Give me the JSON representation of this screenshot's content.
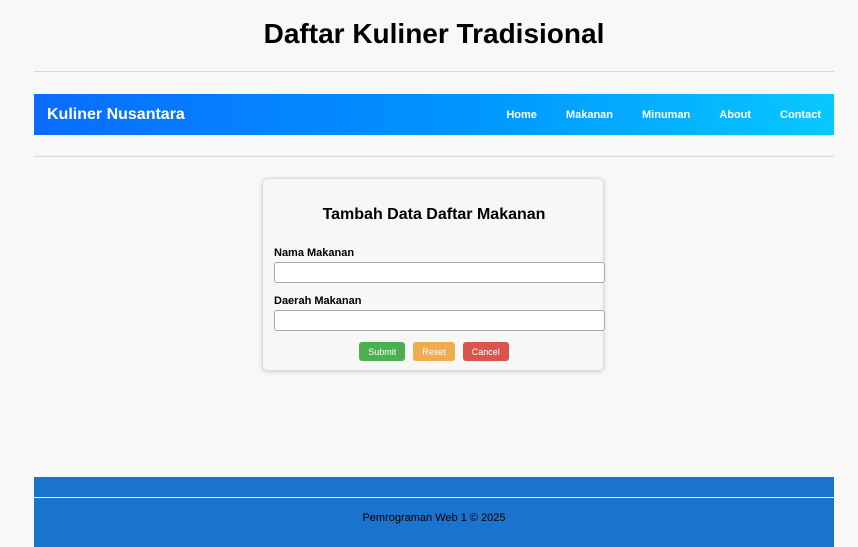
{
  "page": {
    "title": "Daftar Kuliner Tradisional"
  },
  "navbar": {
    "brand": "Kuliner Nusantara",
    "links": [
      "Home",
      "Makanan",
      "Minuman",
      "About",
      "Contact"
    ],
    "gradient_start": "#0a6cff",
    "gradient_end": "#08c8ff"
  },
  "form": {
    "title": "Tambah Data Daftar Makanan",
    "fields": [
      {
        "label": "Nama Makanan",
        "value": "",
        "placeholder": ""
      },
      {
        "label": "Daerah Makanan",
        "value": "",
        "placeholder": ""
      }
    ],
    "buttons": {
      "submit": "Submit",
      "reset": "Reset",
      "cancel": "Cancel"
    },
    "colors": {
      "submit": "#4caf50",
      "reset": "#f0ad4e",
      "cancel": "#d9534f"
    }
  },
  "footer": {
    "text": "Pemrograman Web 1 © 2025",
    "background": "#1a73cc"
  }
}
